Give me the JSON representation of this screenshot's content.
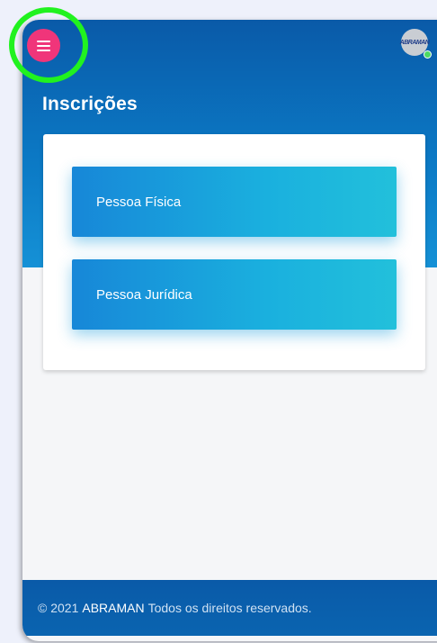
{
  "header": {
    "title": "Inscrições",
    "avatar_logo": "ABRAMAN"
  },
  "options": [
    {
      "label": "Pessoa Física"
    },
    {
      "label": "Pessoa Jurídica"
    }
  ],
  "footer": {
    "copyright": "© 2021",
    "brand": "ABRAMAN",
    "rights": "Todos os direitos reservados."
  },
  "colors": {
    "primary": "#0b78c4",
    "accent": "#f0357a",
    "highlight": "#21f21f",
    "online": "#4cd964"
  },
  "icons": {
    "menu": "hamburger-icon",
    "status": "online-dot"
  }
}
